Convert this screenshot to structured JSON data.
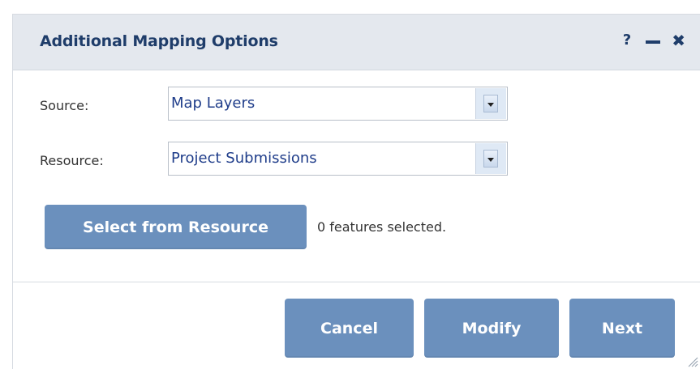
{
  "dialog": {
    "title": "Additional Mapping Options",
    "icons": {
      "help": "?",
      "minimize": "minimize-icon",
      "close": "✖"
    }
  },
  "form": {
    "source": {
      "label": "Source:",
      "value": "Map Layers"
    },
    "resource": {
      "label": "Resource:",
      "value": "Project Submissions"
    }
  },
  "selection": {
    "button_label": "Select from Resource",
    "status": "0 features selected."
  },
  "footer": {
    "cancel_label": "Cancel",
    "modify_label": "Modify",
    "next_label": "Next"
  },
  "colors": {
    "accent": "#6b90bd",
    "title_text": "#1f3d6a",
    "titlebar_bg": "#e4e8ee"
  }
}
